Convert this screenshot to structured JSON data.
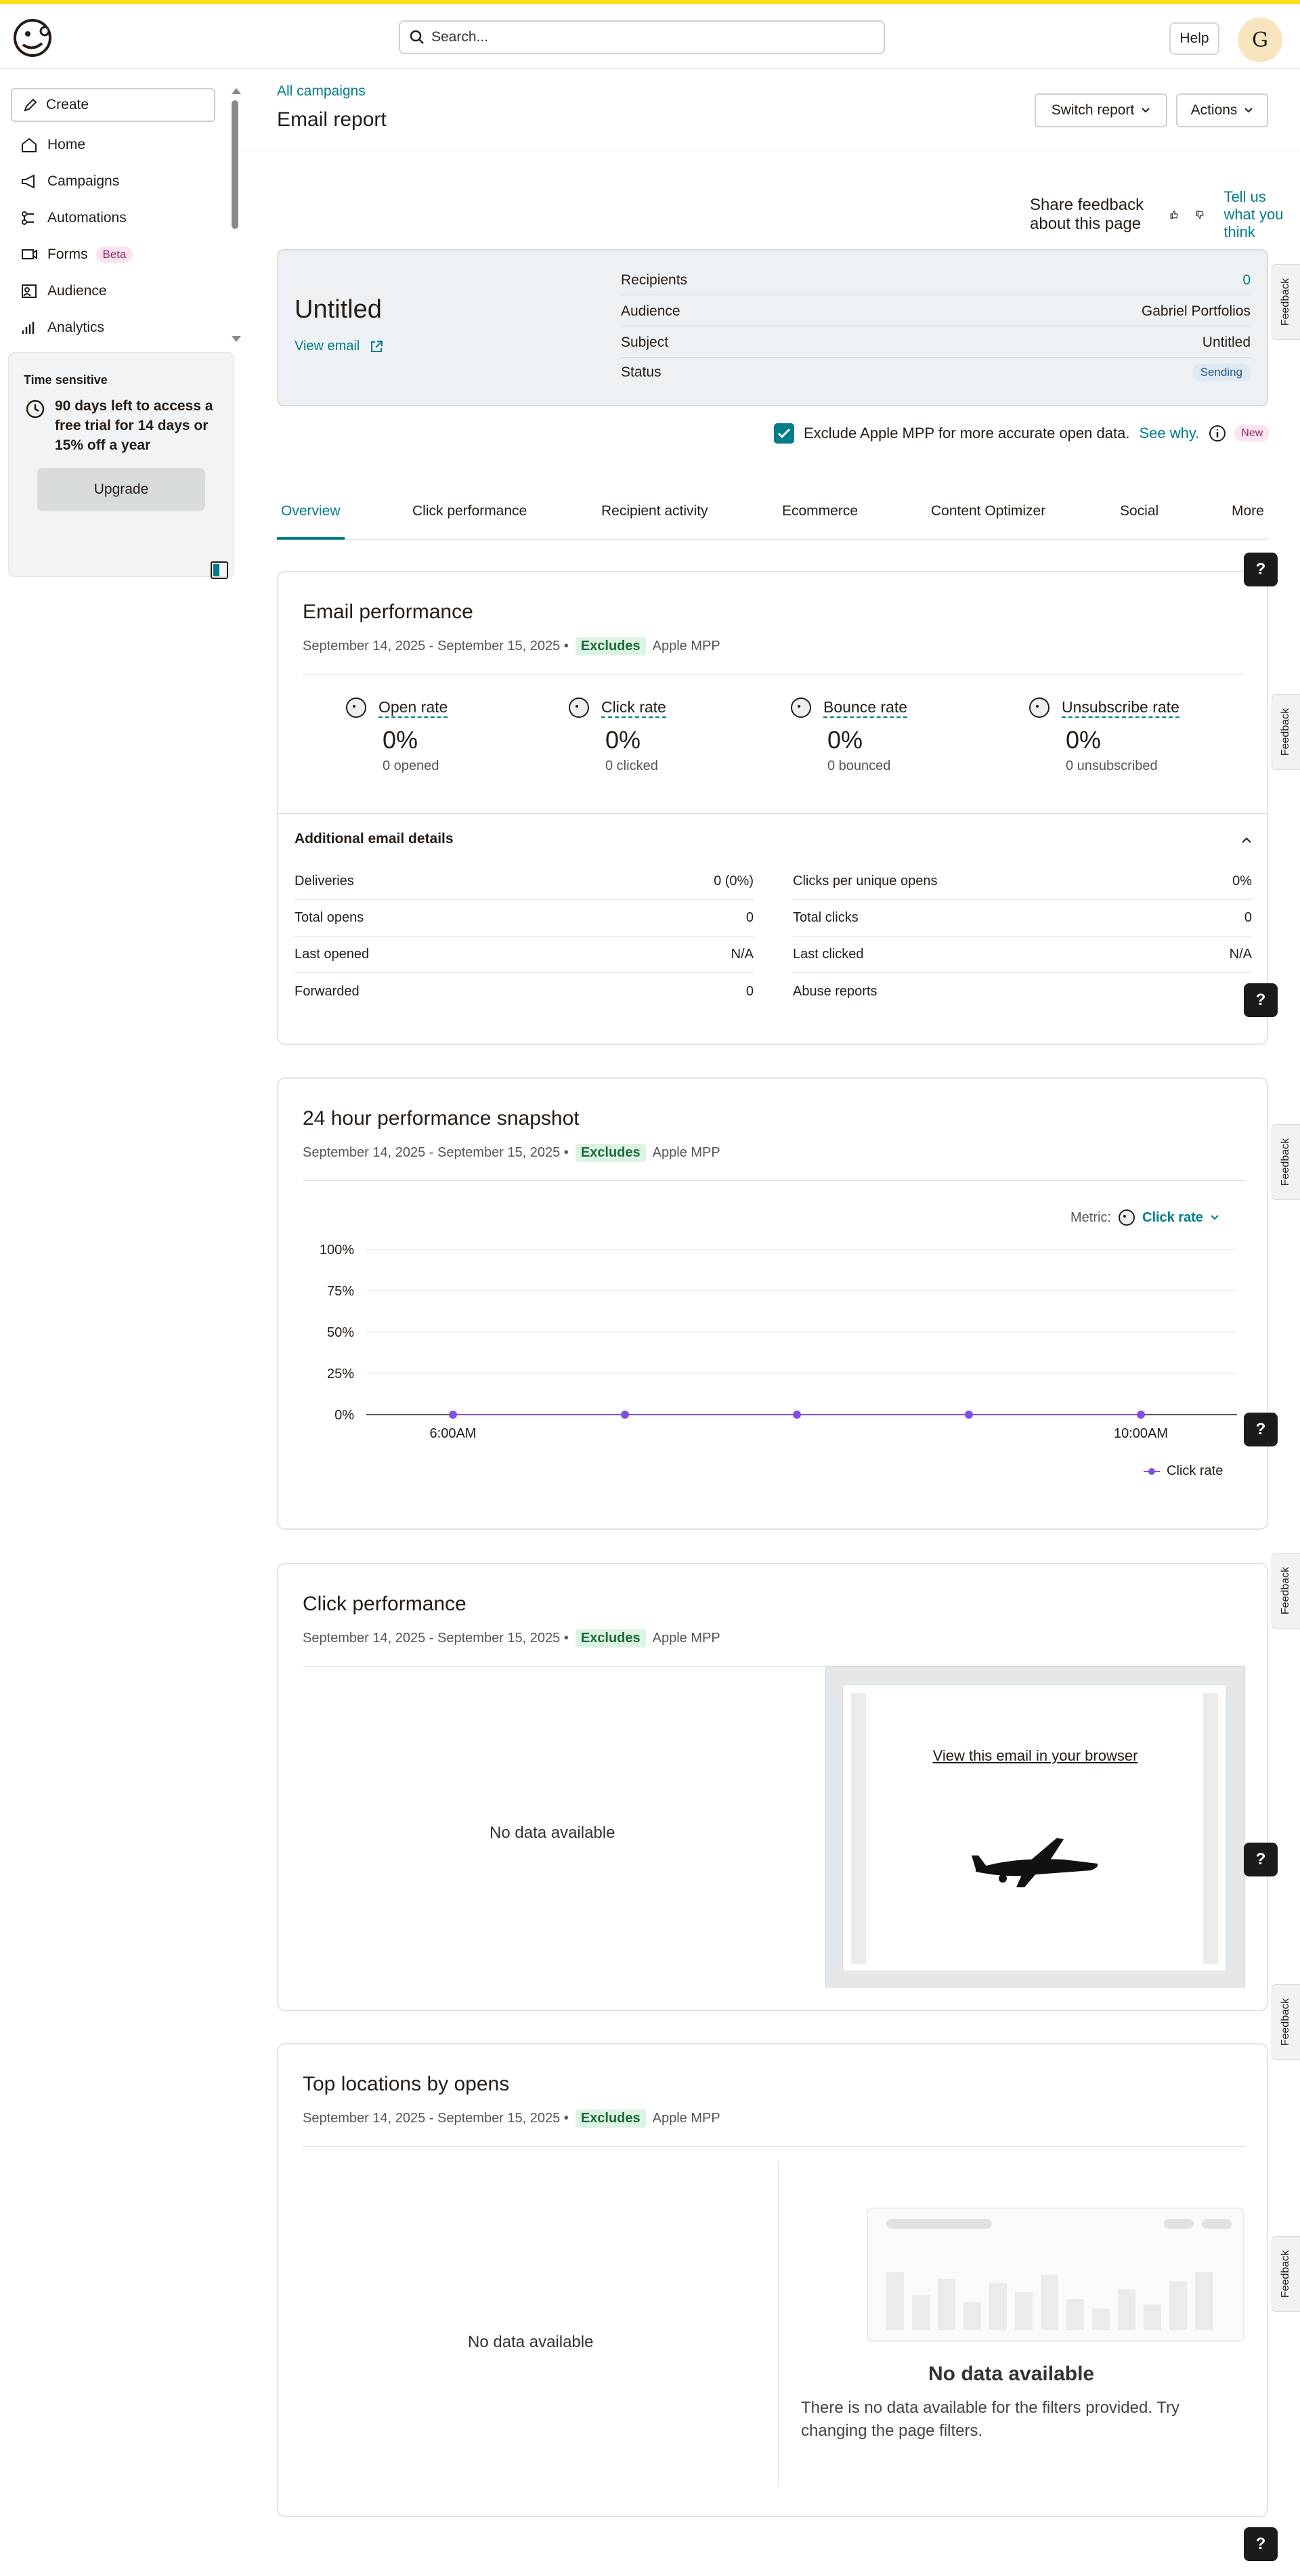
{
  "search": {
    "placeholder": "Search..."
  },
  "header": {
    "help_label": "Help",
    "avatar_initial": "G"
  },
  "sidebar": {
    "create_label": "Create",
    "items": [
      {
        "label": "Home",
        "icon": "home-icon"
      },
      {
        "label": "Campaigns",
        "icon": "megaphone-icon"
      },
      {
        "label": "Automations",
        "icon": "automation-icon"
      },
      {
        "label": "Forms",
        "icon": "forms-icon",
        "badge": "Beta"
      },
      {
        "label": "Audience",
        "icon": "audience-icon"
      },
      {
        "label": "Analytics",
        "icon": "analytics-icon"
      }
    ],
    "promo": {
      "tag": "Time sensitive",
      "text": "90 days left to access a free trial for 14 days or 15% off a year",
      "button": "Upgrade"
    }
  },
  "page": {
    "breadcrumb": "All campaigns",
    "title": "Email report",
    "switch_report": "Switch report",
    "actions": "Actions",
    "feedback_prompt": "Share feedback about this page",
    "feedback_link": "Tell us what you think"
  },
  "summary": {
    "campaign_name": "Untitled",
    "view_email": "View email",
    "rows": [
      {
        "label": "Recipients",
        "value": "0"
      },
      {
        "label": "Audience",
        "value": "Gabriel Portfolios"
      },
      {
        "label": "Subject",
        "value": "Untitled"
      },
      {
        "label": "Status",
        "value": "Sending"
      }
    ]
  },
  "mpp": {
    "label": "Exclude Apple MPP for more accurate open data.",
    "see_why": "See why.",
    "badge": "New",
    "checked": true
  },
  "tabs": [
    "Overview",
    "Click performance",
    "Recipient activity",
    "Ecommerce",
    "Content Optimizer",
    "Social",
    "More"
  ],
  "date_range": "September 14, 2025 - September 15, 2025 •",
  "excludes_label": "Excludes",
  "apple_mpp": "Apple MPP",
  "email_performance": {
    "title": "Email performance",
    "stats": [
      {
        "label": "Open rate",
        "value": "0%",
        "sub": "0 opened"
      },
      {
        "label": "Click rate",
        "value": "0%",
        "sub": "0 clicked"
      },
      {
        "label": "Bounce rate",
        "value": "0%",
        "sub": "0 bounced"
      },
      {
        "label": "Unsubscribe rate",
        "value": "0%",
        "sub": "0 unsubscribed"
      }
    ],
    "additional_title": "Additional email details",
    "left_details": [
      {
        "label": "Deliveries",
        "value": "0 (0%)"
      },
      {
        "label": "Total opens",
        "value": "0"
      },
      {
        "label": "Last opened",
        "value": "N/A"
      },
      {
        "label": "Forwarded",
        "value": "0"
      }
    ],
    "right_details": [
      {
        "label": "Clicks per unique opens",
        "value": "0%"
      },
      {
        "label": "Total clicks",
        "value": "0"
      },
      {
        "label": "Last clicked",
        "value": "N/A"
      },
      {
        "label": "Abuse reports",
        "value": "0"
      }
    ]
  },
  "snapshot": {
    "title": "24 hour performance snapshot",
    "metric_label": "Metric:",
    "metric_value": "Click rate"
  },
  "chart_data": {
    "type": "line",
    "x": [
      "6:00AM",
      "",
      "",
      "",
      "10:00AM"
    ],
    "series": [
      {
        "name": "Click rate",
        "values": [
          0,
          0,
          0,
          0,
          0
        ],
        "color": "#8250df"
      }
    ],
    "y_ticks": [
      "100%",
      "75%",
      "50%",
      "25%",
      "0%"
    ],
    "ylim": [
      0,
      100
    ],
    "grid": true,
    "legend": "bottom-right"
  },
  "click_performance": {
    "title": "Click performance",
    "no_data": "No data available",
    "preview_link": "View this email in your browser"
  },
  "top_locations": {
    "title": "Top locations by opens",
    "no_data_left": "No data available",
    "no_data_title": "No data available",
    "no_data_text": "There is no data available for the filters provided. Try changing the page filters."
  },
  "feedback_tab": "Feedback",
  "help_q": "?"
}
